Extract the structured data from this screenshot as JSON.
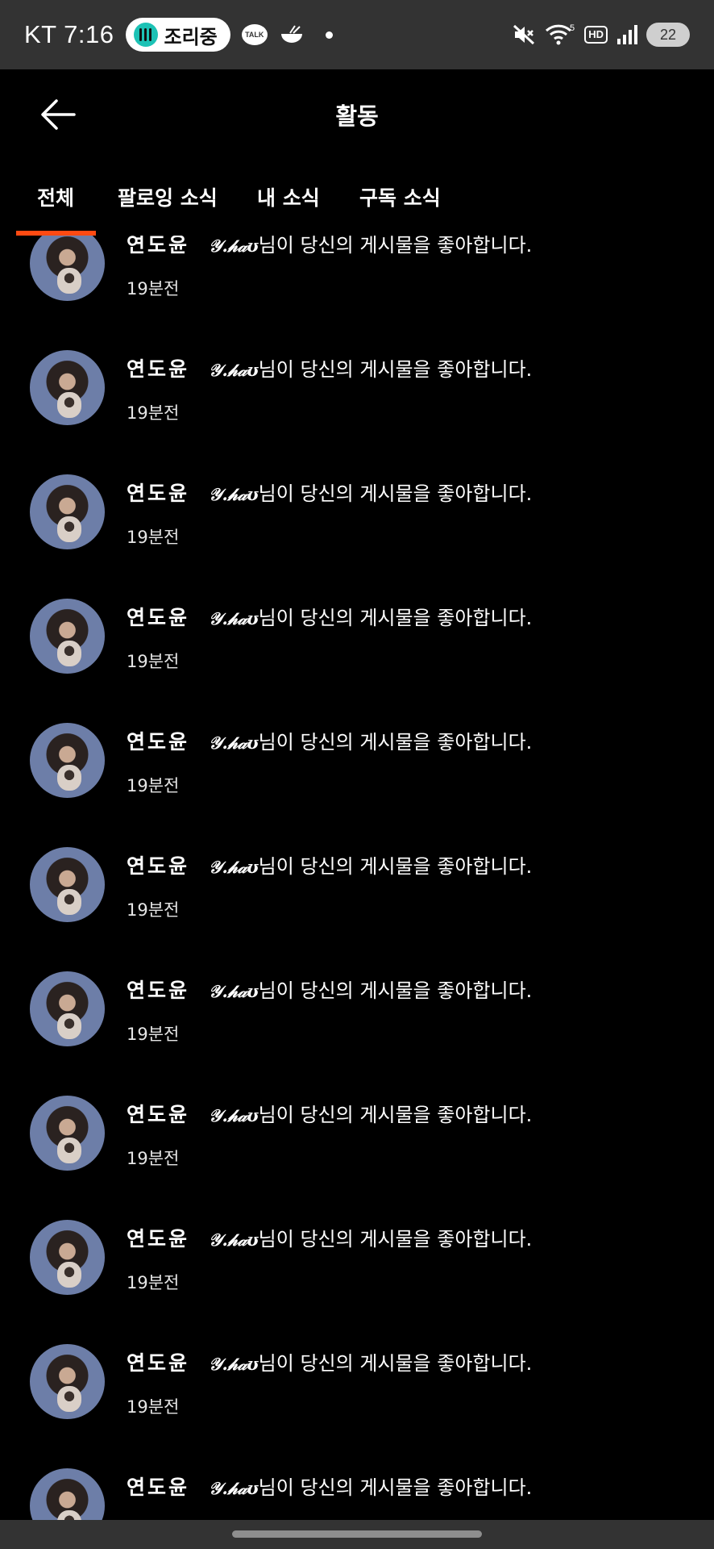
{
  "status_bar": {
    "carrier_time": "KT 7:16",
    "cooking_label": "조리중",
    "talk_label": "TALK",
    "signal_label": "5",
    "hd_label": "HD",
    "battery": "22"
  },
  "header": {
    "title": "활동"
  },
  "tabs": [
    {
      "label": "전체",
      "active": true
    },
    {
      "label": "팔로잉 소식",
      "active": false
    },
    {
      "label": "내 소식",
      "active": false
    },
    {
      "label": "구독 소식",
      "active": false
    }
  ],
  "accent_color": "#ff4a12",
  "notifications": [
    {
      "author": "연도윤",
      "username": "𝒴.𝒽𝒶ʊ",
      "message": "님이 당신의 게시물을 좋아합니다.",
      "time": "19분전"
    },
    {
      "author": "연도윤",
      "username": "𝒴.𝒽𝒶ʊ",
      "message": "님이 당신의 게시물을 좋아합니다.",
      "time": "19분전"
    },
    {
      "author": "연도윤",
      "username": "𝒴.𝒽𝒶ʊ",
      "message": "님이 당신의 게시물을 좋아합니다.",
      "time": "19분전"
    },
    {
      "author": "연도윤",
      "username": "𝒴.𝒽𝒶ʊ",
      "message": "님이 당신의 게시물을 좋아합니다.",
      "time": "19분전"
    },
    {
      "author": "연도윤",
      "username": "𝒴.𝒽𝒶ʊ",
      "message": "님이 당신의 게시물을 좋아합니다.",
      "time": "19분전"
    },
    {
      "author": "연도윤",
      "username": "𝒴.𝒽𝒶ʊ",
      "message": "님이 당신의 게시물을 좋아합니다.",
      "time": "19분전"
    },
    {
      "author": "연도윤",
      "username": "𝒴.𝒽𝒶ʊ",
      "message": "님이 당신의 게시물을 좋아합니다.",
      "time": "19분전"
    },
    {
      "author": "연도윤",
      "username": "𝒴.𝒽𝒶ʊ",
      "message": "님이 당신의 게시물을 좋아합니다.",
      "time": "19분전"
    },
    {
      "author": "연도윤",
      "username": "𝒴.𝒽𝒶ʊ",
      "message": "님이 당신의 게시물을 좋아합니다.",
      "time": "19분전"
    },
    {
      "author": "연도윤",
      "username": "𝒴.𝒽𝒶ʊ",
      "message": "님이 당신의 게시물을 좋아합니다.",
      "time": "19분전"
    },
    {
      "author": "연도윤",
      "username": "𝒴.𝒽𝒶ʊ",
      "message": "님이 당신의 게시물을 좋아합니다.",
      "time": ""
    }
  ]
}
